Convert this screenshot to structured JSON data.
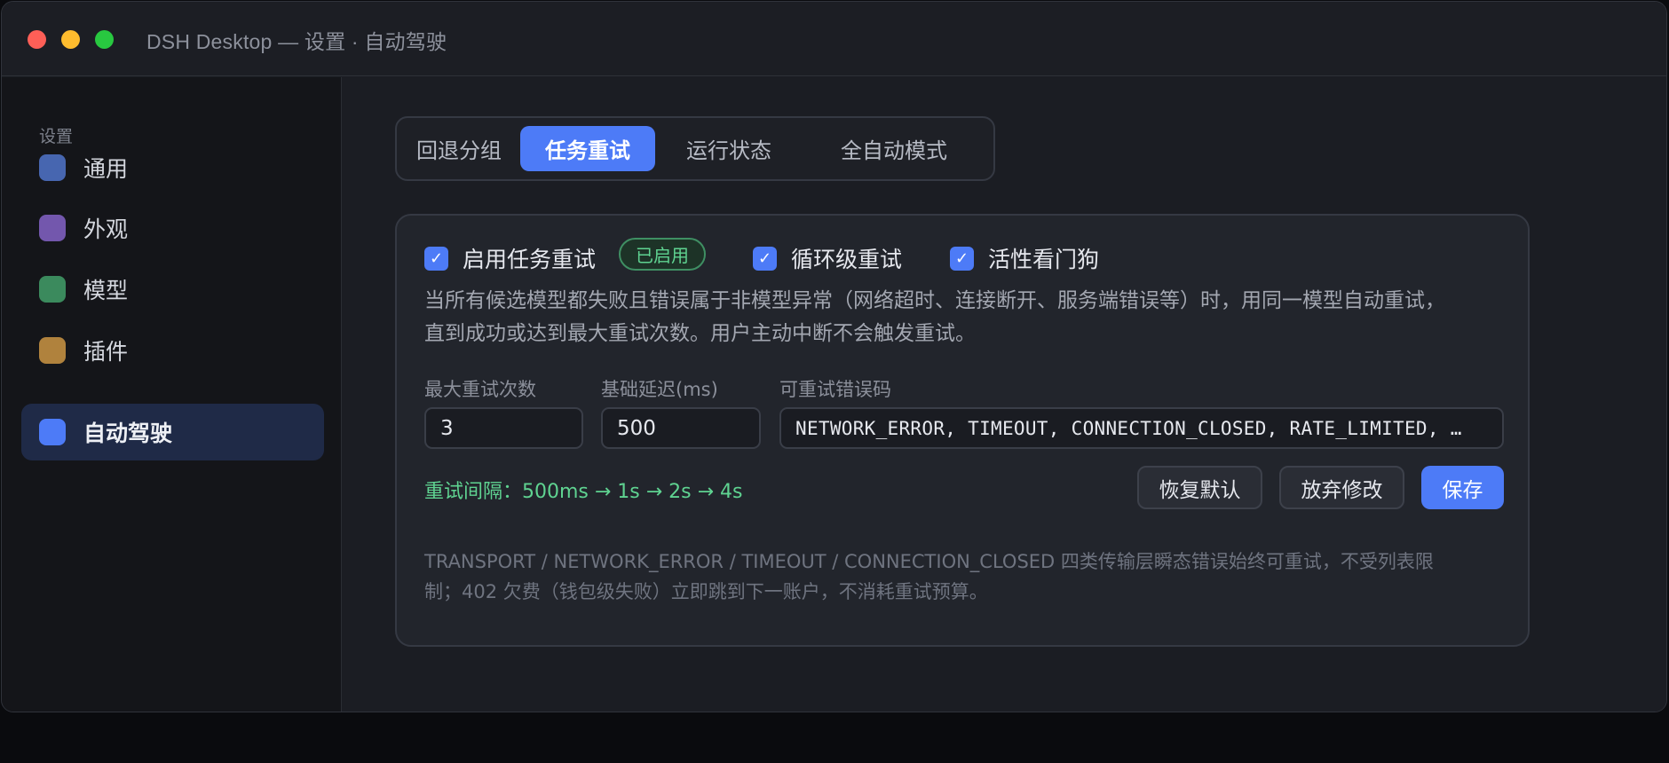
{
  "window": {
    "title": "DSH Desktop — 设置 · 自动驾驶"
  },
  "colors": {
    "accent": "#4d7bf7",
    "success": "#5fd391",
    "close": "#fe5f57",
    "minimize": "#febc2e",
    "zoom": "#28c840"
  },
  "sidebar": {
    "heading": "设置",
    "items": [
      {
        "label": "通用",
        "icon": "general-icon",
        "color": "#4766b0"
      },
      {
        "label": "外观",
        "icon": "appearance-icon",
        "color": "#7357ad"
      },
      {
        "label": "模型",
        "icon": "model-icon",
        "color": "#3b8a5d"
      },
      {
        "label": "插件",
        "icon": "plugin-icon",
        "color": "#b0823d"
      },
      {
        "label": "自动驾驶",
        "icon": "autopilot-icon",
        "color": "#4d7bf7",
        "active": true
      }
    ]
  },
  "tabs": [
    {
      "label": "回退分组"
    },
    {
      "label": "任务重试",
      "active": true
    },
    {
      "label": "运行状态"
    },
    {
      "label": "全自动模式"
    }
  ],
  "retry": {
    "enable_label": "启用任务重试",
    "enable_checked": true,
    "status_badge": "已启用",
    "loop_label": "循环级重试",
    "loop_checked": true,
    "watchdog_label": "活性看门狗",
    "watchdog_checked": true,
    "check_mark": "✓",
    "description_line1": "当所有候选模型都失败且错误属于非模型异常（网络超时、连接断开、服务端错误等）时，用同一模型自动重试，",
    "description_line2": "直到成功或达到最大重试次数。用户主动中断不会触发重试。",
    "max_retries_label": "最大重试次数",
    "max_retries_value": "3",
    "base_delay_label": "基础延迟(ms)",
    "base_delay_value": "500",
    "error_codes_label": "可重试错误码",
    "error_codes_value": "NETWORK_ERROR, TIMEOUT, CONNECTION_CLOSED, RATE_LIMITED, …",
    "interval_text": "重试间隔：500ms → 1s → 2s → 4s",
    "reset_button": "恢复默认",
    "discard_button": "放弃修改",
    "save_button": "保存",
    "footnote_line1": "TRANSPORT / NETWORK_ERROR / TIMEOUT / CONNECTION_CLOSED 四类传输层瞬态错误始终可重试，不受列表限",
    "footnote_line2": "制；402 欠费（钱包级失败）立即跳到下一账户，不消耗重试预算。"
  }
}
